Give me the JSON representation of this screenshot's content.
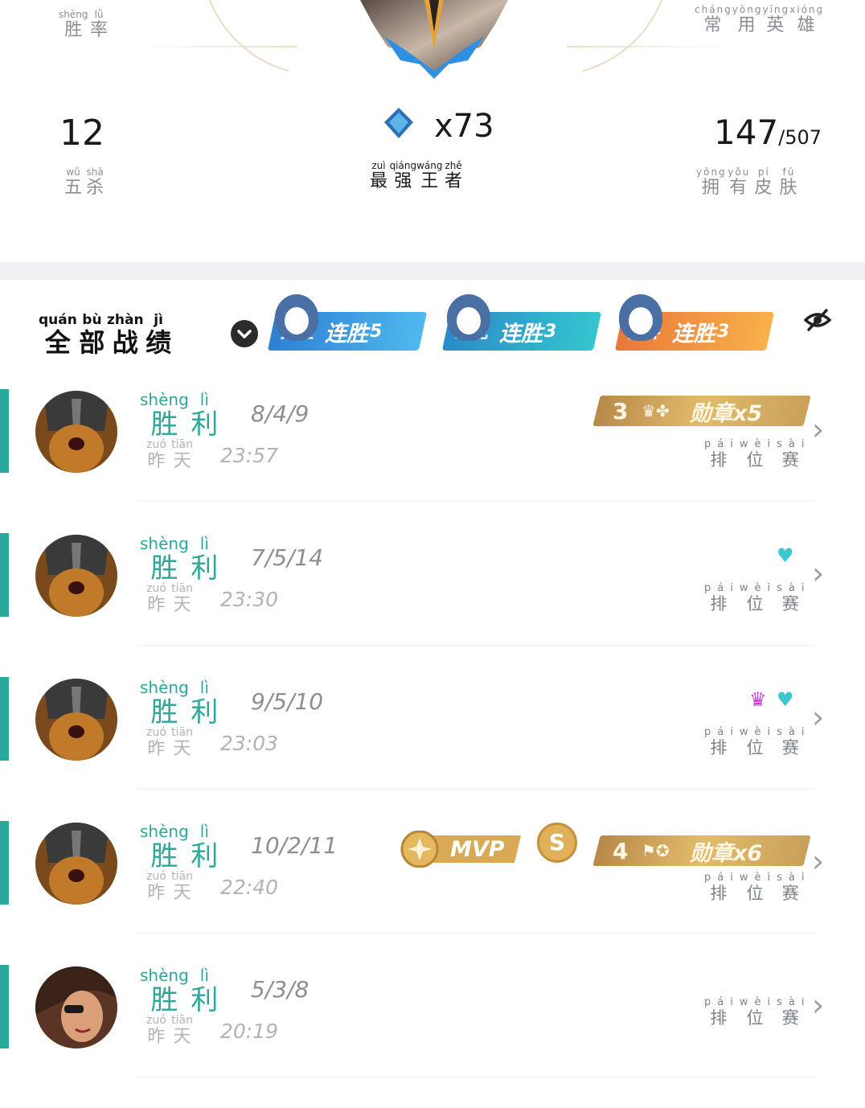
{
  "header": {
    "win_rate_label": {
      "hanzi": [
        "胜",
        "率"
      ],
      "pinyin": [
        "shèng",
        "lǜ"
      ]
    },
    "common_heroes_label": {
      "hanzi": [
        "常",
        "用",
        "英",
        "雄"
      ],
      "pinyin": [
        "cháng",
        "yòng",
        "yīng",
        "xióng"
      ]
    },
    "pentakills": {
      "value": "12",
      "hanzi": [
        "五",
        "杀"
      ],
      "pinyin": [
        "wǔ",
        "shā"
      ]
    },
    "strongest_king": {
      "count": "x73",
      "hanzi": [
        "最",
        "强",
        "王",
        "者"
      ],
      "pinyin": [
        "zuì",
        "qiáng",
        "wáng",
        "zhě"
      ]
    },
    "skins": {
      "owned": "147",
      "total": "/507",
      "hanzi": [
        "拥",
        "有",
        "皮",
        "肤"
      ],
      "pinyin": [
        "yōng",
        "yǒu",
        "pí",
        "fū"
      ]
    }
  },
  "filter": {
    "title": {
      "hanzi": [
        "全",
        "部",
        "战",
        "绩"
      ],
      "pinyin": [
        "quán",
        "bù",
        "zhàn",
        "jì"
      ]
    },
    "streaks": [
      {
        "tag": "排位",
        "text": "连胜",
        "count": "5",
        "color": "#3aa7e6"
      },
      {
        "tag": "匹配",
        "text": "连胜",
        "count": "3",
        "color": "#25b3c6"
      },
      {
        "tag": "乱斗",
        "text": "连胜",
        "count": "3",
        "color": "#f3963a"
      }
    ],
    "hide_icon": "eye-slash-icon"
  },
  "matches": [
    {
      "result": {
        "hanzi": [
          "胜",
          "利"
        ],
        "pinyin": [
          "shèng",
          "lì"
        ]
      },
      "kda": "8/4/9",
      "day": {
        "hanzi": [
          "昨",
          "天"
        ],
        "pinyin": [
          "zuó",
          "tiān"
        ]
      },
      "time": "23:57",
      "mode": {
        "hanzi": [
          "排",
          "位",
          "赛"
        ],
        "pinyin": [
          "pái",
          "wèi",
          "sài"
        ]
      },
      "medal": {
        "num": "3",
        "label": "勋章x5"
      }
    },
    {
      "result": {
        "hanzi": [
          "胜",
          "利"
        ],
        "pinyin": [
          "shèng",
          "lì"
        ]
      },
      "kda": "7/5/14",
      "day": {
        "hanzi": [
          "昨",
          "天"
        ],
        "pinyin": [
          "zuó",
          "tiān"
        ]
      },
      "time": "23:30",
      "mode": {
        "hanzi": [
          "排",
          "位",
          "赛"
        ],
        "pinyin": [
          "pái",
          "wèi",
          "sài"
        ]
      }
    },
    {
      "result": {
        "hanzi": [
          "胜",
          "利"
        ],
        "pinyin": [
          "shèng",
          "lì"
        ]
      },
      "kda": "9/5/10",
      "day": {
        "hanzi": [
          "昨",
          "天"
        ],
        "pinyin": [
          "zuó",
          "tiān"
        ]
      },
      "time": "23:03",
      "mode": {
        "hanzi": [
          "排",
          "位",
          "赛"
        ],
        "pinyin": [
          "pái",
          "wèi",
          "sài"
        ]
      }
    },
    {
      "result": {
        "hanzi": [
          "胜",
          "利"
        ],
        "pinyin": [
          "shèng",
          "lì"
        ]
      },
      "kda": "10/2/11",
      "day": {
        "hanzi": [
          "昨",
          "天"
        ],
        "pinyin": [
          "zuó",
          "tiān"
        ]
      },
      "time": "22:40",
      "mode": {
        "hanzi": [
          "排",
          "位",
          "赛"
        ],
        "pinyin": [
          "pái",
          "wèi",
          "sài"
        ]
      },
      "mvp": "MVP",
      "s_badge": "S",
      "medal": {
        "num": "4",
        "label": "勋章x6"
      }
    },
    {
      "result": {
        "hanzi": [
          "胜",
          "利"
        ],
        "pinyin": [
          "shèng",
          "lì"
        ]
      },
      "kda": "5/3/8",
      "day": {
        "hanzi": [
          "昨",
          "天"
        ],
        "pinyin": [
          "zuó",
          "tiān"
        ]
      },
      "time": "20:19",
      "mode": {
        "hanzi": [
          "排",
          "位",
          "赛"
        ],
        "pinyin": [
          "pái",
          "wèi",
          "sài"
        ]
      }
    }
  ],
  "colors": {
    "accent": "#2aa99b",
    "medal_gold": "#d6ac5e"
  }
}
